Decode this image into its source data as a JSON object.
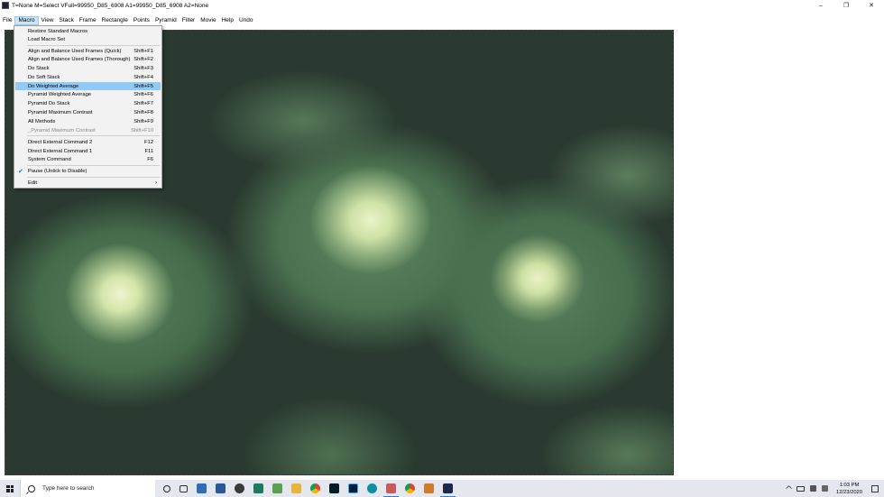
{
  "window": {
    "title": "T=None M=Select VFull=99950_D85_6908 A1=99950_D85_6908 A2=None",
    "controls": {
      "minimize": "–",
      "maximize": "❐",
      "close": "✕"
    }
  },
  "menubar": {
    "items": [
      "File",
      "Macro",
      "View",
      "Stack",
      "Frame",
      "Rectangle",
      "Points",
      "Pyramid",
      "Filter",
      "Movie",
      "Help",
      "Undo"
    ],
    "active": "Macro"
  },
  "macro_menu": {
    "items": [
      {
        "label": "Restore Standard Macros",
        "shortcut": ""
      },
      {
        "label": "Load Macro Set",
        "shortcut": ""
      },
      {
        "label": "Align and Balance Used Frames (Quick)",
        "shortcut": "Shift+F1"
      },
      {
        "label": "Align and Balance Used Frames (Thorough)",
        "shortcut": "Shift+F2"
      },
      {
        "label": "Do Stack",
        "shortcut": "Shift+F3"
      },
      {
        "label": "Do Soft Stack",
        "shortcut": "Shift+F4"
      },
      {
        "label": "Do Weighted Average",
        "shortcut": "Shift+F5"
      },
      {
        "label": "Pyramid Weighted Average",
        "shortcut": "Shift+F6"
      },
      {
        "label": "Pyramid Do Stack",
        "shortcut": "Shift+F7"
      },
      {
        "label": "Pyramid Maximum Contrast",
        "shortcut": "Shift+F8"
      },
      {
        "label": "All Methods",
        "shortcut": "Shift+F9"
      },
      {
        "label": "_Pyramid Maximum Contrast",
        "shortcut": "Shift+F10"
      },
      {
        "label": "Direct External Command 2",
        "shortcut": "F12"
      },
      {
        "label": "Direct External Command 1",
        "shortcut": "F11"
      },
      {
        "label": "System Command",
        "shortcut": "F6"
      },
      {
        "label": "Pause (Untick to Disable)",
        "shortcut": ""
      },
      {
        "label": "Edit",
        "shortcut": ""
      }
    ],
    "highlighted": "Do Weighted Average",
    "disabled": "_Pyramid Maximum Contrast",
    "checked": "Pause (Untick to Disable)",
    "submenu": "Edit"
  },
  "taskbar": {
    "search_placeholder": "Type here to search",
    "apps": [
      "task-view-icon",
      "taskbar-app-icon",
      "word-icon",
      "photos-app-icon",
      "sheets-icon",
      "file-explorer-icon",
      "chrome-icon",
      "lightroom-icon",
      "chrome-icon-2",
      "edge-icon",
      "files-icon",
      "chrome-icon-3",
      "tool-icon",
      "zerene-icon"
    ],
    "time": "1:03 PM",
    "date": "12/23/2020"
  }
}
